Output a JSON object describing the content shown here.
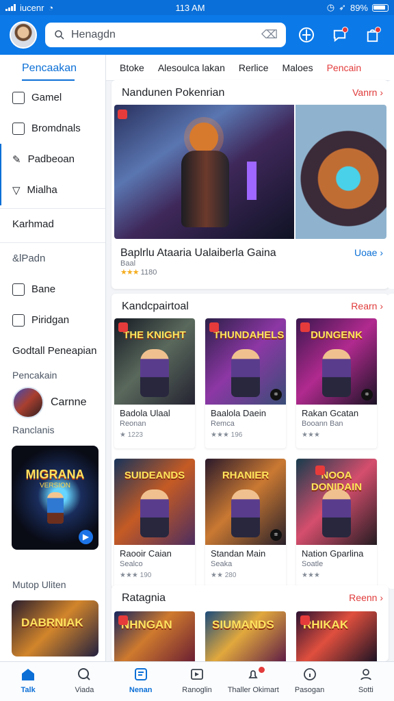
{
  "status": {
    "carrier": "iucenr",
    "time": "113 AM",
    "battery": "89%"
  },
  "header": {
    "search_text": "Henagdn"
  },
  "sidebar": {
    "title": "Pencaakan",
    "items": [
      {
        "label": "Gamel",
        "icon": "controller-icon"
      },
      {
        "label": "Bromdnals",
        "icon": "bookmark-icon"
      },
      {
        "label": "Padbeoan",
        "icon": "edit-icon"
      },
      {
        "label": "Mialha",
        "icon": "triangle-icon"
      }
    ],
    "headings": [
      "Karhmad",
      "&lPadn",
      "Bane",
      "Piridgan",
      "Godtall Peneapian"
    ],
    "small_label": "Pencakain",
    "user_label": "Carnne",
    "section_label": "Ranclanis",
    "promo_title": "MIGRANA",
    "promo_subtitle": "VERSION",
    "footer_label": "Mutop Uliten",
    "footer_promo": "DABRNIAK"
  },
  "tabs": [
    "Btoke",
    "Alesoulca lakan",
    "Rerlice",
    "Maloes",
    "Pencain"
  ],
  "featured": {
    "section": "Nandunen Pokenrian",
    "link": "Vanrn",
    "title": "Baplrlu Ataaria Ualaiberla Gaina",
    "subtitle": "Baal",
    "rating_stars": "★★★",
    "rating": "1180",
    "link_bottom": "Uoae"
  },
  "grid_section": {
    "title": "Kandcpairtoal",
    "link": "Rearn"
  },
  "games": [
    {
      "title": "Badola Ulaal",
      "subtitle": "Reonan",
      "rating": "★ 1223",
      "art": "THE KNIGHT",
      "colors": [
        "#151923",
        "#5a695c",
        "#242331"
      ]
    },
    {
      "title": "Baalola Daein",
      "subtitle": "Remca",
      "rating": "★★★ 196",
      "art": "THUNDAHELS",
      "colors": [
        "#2c2048",
        "#8d37a5",
        "#394d77"
      ]
    },
    {
      "title": "Rakan Gcatan",
      "subtitle": "Booann Ban",
      "rating": "★★★",
      "art": "DUNGENK",
      "colors": [
        "#3b174e",
        "#b12a8f",
        "#1a1324"
      ]
    },
    {
      "title": "Raooir Caian",
      "subtitle": "Sealco",
      "rating": "★★★ 190",
      "art": "SUIDEANDS",
      "colors": [
        "#17335b",
        "#c55b24",
        "#4c2d5f"
      ]
    },
    {
      "title": "Standan Main",
      "subtitle": "Seaka",
      "rating": "★★ 280",
      "art": "RHANIER",
      "colors": [
        "#2a192b",
        "#ca7932",
        "#28202a"
      ]
    },
    {
      "title": "Nation Gparlina",
      "subtitle": "Soatle",
      "rating": "★★★",
      "art": "NOOA DONIDAIN",
      "colors": [
        "#173c4d",
        "#d54e6d",
        "#241c22"
      ]
    }
  ],
  "bottom_section": {
    "title": "Ratagnia",
    "link": "Reenn",
    "art": [
      "NHNGAN",
      "SIUMANDS",
      "RHIKAK"
    ]
  },
  "bottom_nav": [
    {
      "label": "Talk",
      "icon": "home-icon"
    },
    {
      "label": "Viada",
      "icon": "search-icon"
    },
    {
      "label": "Nenan",
      "icon": "book-icon"
    },
    {
      "label": "Ranoglin",
      "icon": "play-box-icon"
    },
    {
      "label": "Thaller Okimart",
      "icon": "bell-icon"
    },
    {
      "label": "Pasogan",
      "icon": "info-icon"
    },
    {
      "label": "Sotti",
      "icon": "profile-icon"
    }
  ],
  "colors": {
    "accent": "#0b79e8",
    "danger": "#e33b3b",
    "star": "#f4ad1f"
  }
}
